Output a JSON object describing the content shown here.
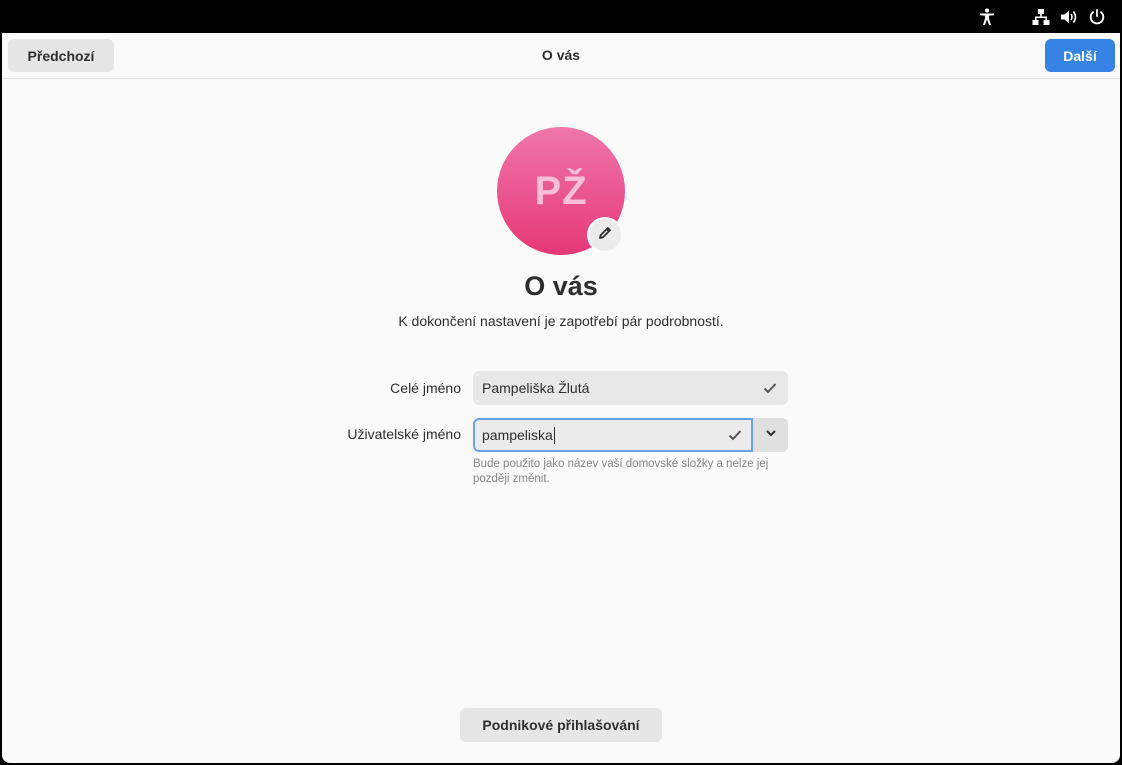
{
  "system_tray": {
    "icons": [
      "accessibility-icon",
      "network-wired-icon",
      "volume-icon",
      "power-icon"
    ]
  },
  "header": {
    "back_label": "Předchozí",
    "title": "O vás",
    "next_label": "Další"
  },
  "avatar": {
    "initials": "PŽ",
    "edit_icon": "pencil-icon"
  },
  "main": {
    "title": "O vás",
    "subtitle": "K dokončení nastavení je zapotřebí pár podrobností.",
    "full_name": {
      "label": "Celé jméno",
      "value": "Pampeliška Žlutá"
    },
    "username": {
      "label": "Uživatelské jméno",
      "value": "pampeliska",
      "hint": "Bude použito jako název vaší domovské složky a nelze jej později změnit."
    },
    "enterprise_login_label": "Podnikové přihlašování"
  },
  "colors": {
    "accent": "#3584e4",
    "avatar_top": "#ef76a9",
    "avatar_bottom": "#e63876",
    "focus_ring": "#6ba2e6"
  }
}
